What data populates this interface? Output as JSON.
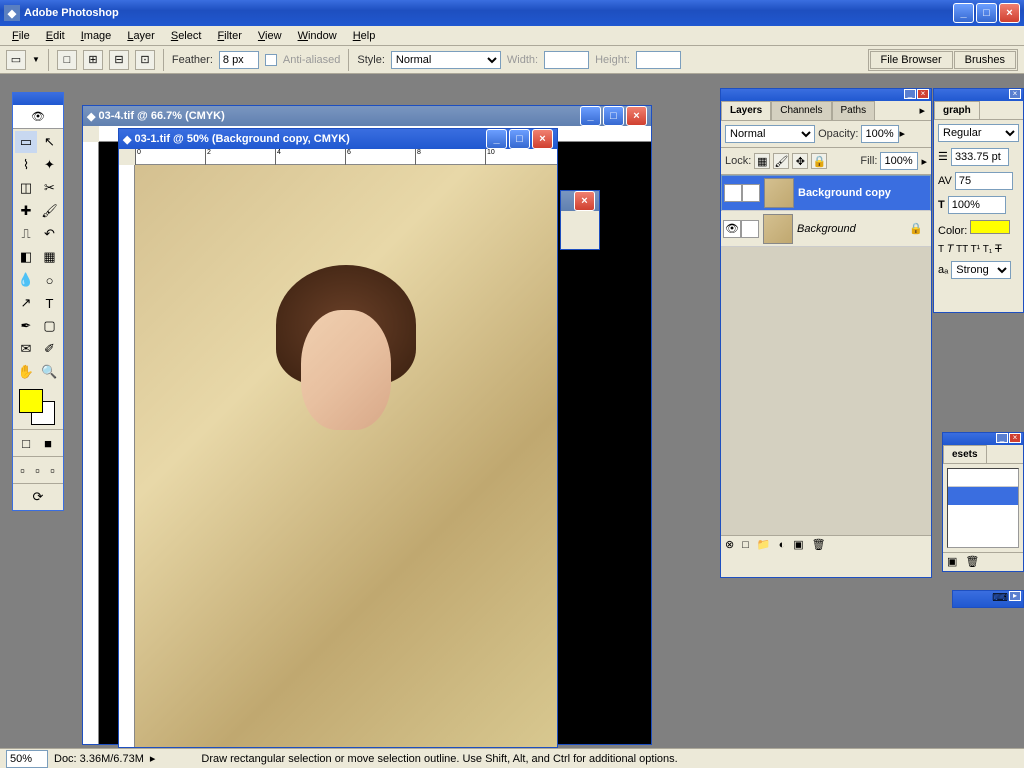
{
  "app": {
    "title": "Adobe Photoshop"
  },
  "menus": [
    "File",
    "Edit",
    "Image",
    "Layer",
    "Select",
    "Filter",
    "View",
    "Window",
    "Help"
  ],
  "options": {
    "feather_label": "Feather:",
    "feather_value": "8 px",
    "aa_label": "Anti-aliased",
    "style_label": "Style:",
    "style_value": "Normal",
    "width_label": "Width:",
    "height_label": "Height:",
    "well_tabs": [
      "File Browser",
      "Brushes"
    ]
  },
  "tools": [
    "marquee",
    "move",
    "lasso",
    "wand",
    "crop",
    "slice",
    "heal",
    "brush",
    "stamp",
    "history",
    "eraser",
    "gradient",
    "blur",
    "dodge",
    "path",
    "type",
    "pen",
    "shape",
    "notes",
    "eyedrop",
    "hand",
    "zoom"
  ],
  "colors": {
    "fg": "#ffff00",
    "bg": "#ffffff"
  },
  "docs": {
    "back": {
      "title": "03-4.tif @ 66.7% (CMYK)"
    },
    "front": {
      "title": "03-1.tif @ 50% (Background copy, CMYK)"
    }
  },
  "layers_panel": {
    "tabs": [
      "Layers",
      "Channels",
      "Paths"
    ],
    "blend": "Normal",
    "opacity_label": "Opacity:",
    "opacity": "100%",
    "lock_label": "Lock:",
    "fill_label": "Fill:",
    "fill": "100%",
    "items": [
      {
        "name": "Background copy",
        "selected": true
      },
      {
        "name": "Background",
        "selected": false,
        "locked": true
      }
    ]
  },
  "char_panel": {
    "tab": "graph",
    "preset": "Regular",
    "size": "333.75 pt",
    "tracking": "75",
    "scale": "100%",
    "color_label": "Color:",
    "color": "#ffff00",
    "aa": "Strong"
  },
  "status": {
    "zoom": "50%",
    "doc": "Doc: 3.36M/6.73M",
    "hint": "Draw rectangular selection or move selection outline. Use Shift, Alt, and Ctrl for additional options."
  }
}
